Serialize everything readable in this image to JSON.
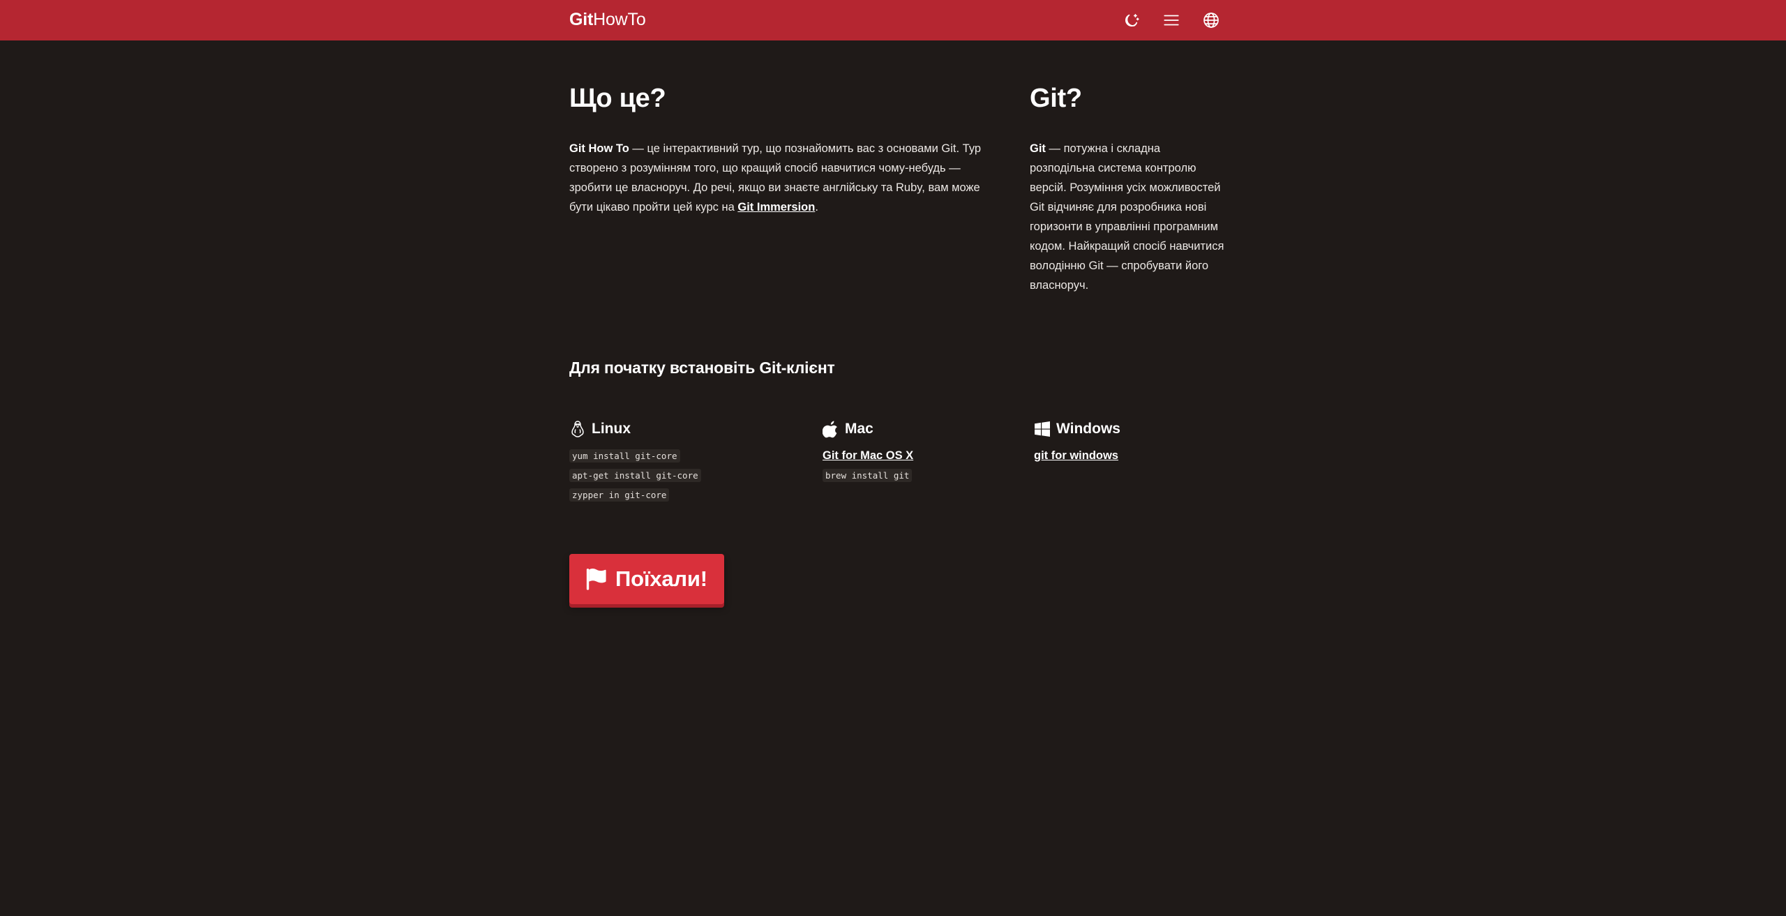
{
  "header": {
    "brand_bold": "Git",
    "brand_rest": "HowTo",
    "icons": [
      "theme-toggle-icon",
      "menu-icon",
      "globe-icon"
    ]
  },
  "intro": {
    "title": "Що це?",
    "lead_bold": "Git How To",
    "text": " — це інтерактивний тур, що познайомить вас з основами Git. Тур створено з розумінням того, що кращий спосіб навчитися чому-небудь — зробити це власноруч. До речі, якщо ви знаєте англійську та Ruby, вам може бути цікаво пройти цей курс на ",
    "link": "Git Immersion",
    "tail": "."
  },
  "git": {
    "title": "Git?",
    "lead_bold": "Git",
    "text": " — потужна і складна розподільна система контролю версій. Розуміння усіх можливостей Git відчиняє для розробника нові горизонти в управлінні програмним кодом. Найкращий спосіб навчитися володінню Git — спробувати його власноруч."
  },
  "install": {
    "title": "Для початку встановіть Git-клієнт",
    "linux": {
      "label": "Linux",
      "icon": "linux-tux-icon",
      "commands": [
        "yum install git-core",
        "apt-get install git-core",
        "zypper in git-core"
      ]
    },
    "mac": {
      "label": "Mac",
      "icon": "apple-icon",
      "link": "Git for Mac OS X",
      "command": "brew install git"
    },
    "windows": {
      "label": "Windows",
      "icon": "windows-icon",
      "link": "git for windows"
    }
  },
  "start_button": {
    "label": "Поїхали!",
    "icon": "flag-icon"
  },
  "colors": {
    "header_bg": "#b52631",
    "page_bg": "#1f1a18",
    "button_bg": "#d9303b"
  }
}
